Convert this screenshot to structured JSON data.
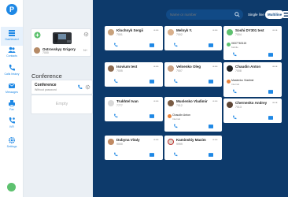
{
  "sidebar": {
    "logo": "P",
    "items": [
      {
        "label": "Dashboard",
        "icon": "dashboard-icon"
      },
      {
        "label": "Contacts",
        "icon": "contacts-icon"
      },
      {
        "label": "Calls history",
        "icon": "calls-history-icon"
      },
      {
        "label": "Messages",
        "icon": "messages-icon"
      },
      {
        "label": "Fax",
        "icon": "fax-icon"
      },
      {
        "label": "IVR",
        "icon": "ivr-icon"
      },
      {
        "label": "Settings",
        "icon": "settings-icon"
      }
    ]
  },
  "device": {
    "name": "Ostrovskyy Grigory",
    "ext": "7000",
    "badge": "N+"
  },
  "conference": {
    "heading": "Conference",
    "card_title": "Conference",
    "card_sub": "Without password",
    "empty": "Empty"
  },
  "search": {
    "placeholder": "Name or number"
  },
  "view": {
    "single": "Single line",
    "multi": "Multiline"
  },
  "contacts": [
    {
      "name": "Klochnyk Sergii",
      "ext": "7001"
    },
    {
      "name": "Melnyk Y.",
      "ext": "7002"
    },
    {
      "name": "Soshi DY301 test",
      "ext": "7004",
      "extra_num": "0637763115",
      "extra_label": "Mobile"
    },
    {
      "name": "Isovium test",
      "ext": "7005"
    },
    {
      "name": "Velnenko Oleg",
      "ext": "7007"
    },
    {
      "name": "Chaudin Anton",
      "ext": "7008",
      "sub_name": "Maslenko Vladimir",
      "sub_state": "Internal"
    },
    {
      "name": "Trukhtel Ivan",
      "ext": "7777"
    },
    {
      "name": "Muslenko Vladimir",
      "ext": "7012",
      "sub_name": "Chaudin Anton",
      "sub_state": "Internal"
    },
    {
      "name": "Chernenko Andrey",
      "ext": "7013"
    },
    {
      "name": "Dubyna Vitaly",
      "ext": "9000"
    },
    {
      "name": "Kaminskiy Maxim",
      "ext": "9999"
    }
  ],
  "colors": {
    "nav_blue": "#1e88e5",
    "panel_dark": "#0d3a6b",
    "presence_online": "#5dc16f",
    "presence_busy": "#e8823a"
  }
}
